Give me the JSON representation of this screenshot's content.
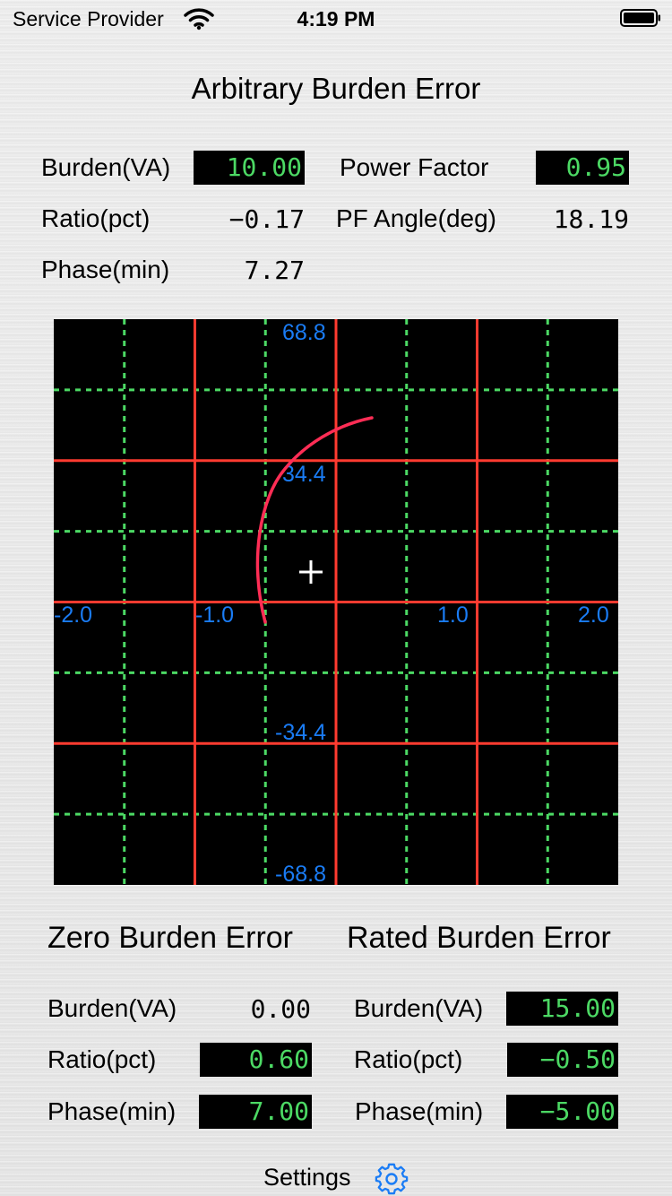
{
  "status_bar": {
    "carrier": "Service Provider",
    "time": "4:19 PM"
  },
  "title": "Arbitrary Burden Error",
  "arbitrary": {
    "burden_label": "Burden(VA)",
    "burden_value": "10.00",
    "power_factor_label": "Power Factor",
    "power_factor_value": "0.95",
    "ratio_label": "Ratio(pct)",
    "ratio_value": "−0.17",
    "pf_angle_label": "PF Angle(deg)",
    "pf_angle_value": "18.19",
    "phase_label": "Phase(min)",
    "phase_value": "7.27"
  },
  "plot": {
    "y_labels": [
      "68.8",
      "34.4",
      "-34.4",
      "-68.8"
    ],
    "x_labels": [
      "-2.0",
      "-1.0",
      "1.0",
      "2.0"
    ],
    "colors": {
      "background": "#000000",
      "major_grid": "#ff3b30",
      "minor_grid": "#4cd964",
      "labels": "#1a7cf5",
      "curve": "#ff2d55",
      "marker": "#ffffff"
    }
  },
  "zero_burden": {
    "title": "Zero Burden Error",
    "burden_label": "Burden(VA)",
    "burden_value": "0.00",
    "ratio_label": "Ratio(pct)",
    "ratio_value": "0.60",
    "phase_label": "Phase(min)",
    "phase_value": "7.00"
  },
  "rated_burden": {
    "title": "Rated Burden Error",
    "burden_label": "Burden(VA)",
    "burden_value": "15.00",
    "ratio_label": "Ratio(pct)",
    "ratio_value": "−0.50",
    "phase_label": "Phase(min)",
    "phase_value": "−5.00"
  },
  "footer": {
    "settings_label": "Settings",
    "settings_icon": "gear-icon"
  }
}
